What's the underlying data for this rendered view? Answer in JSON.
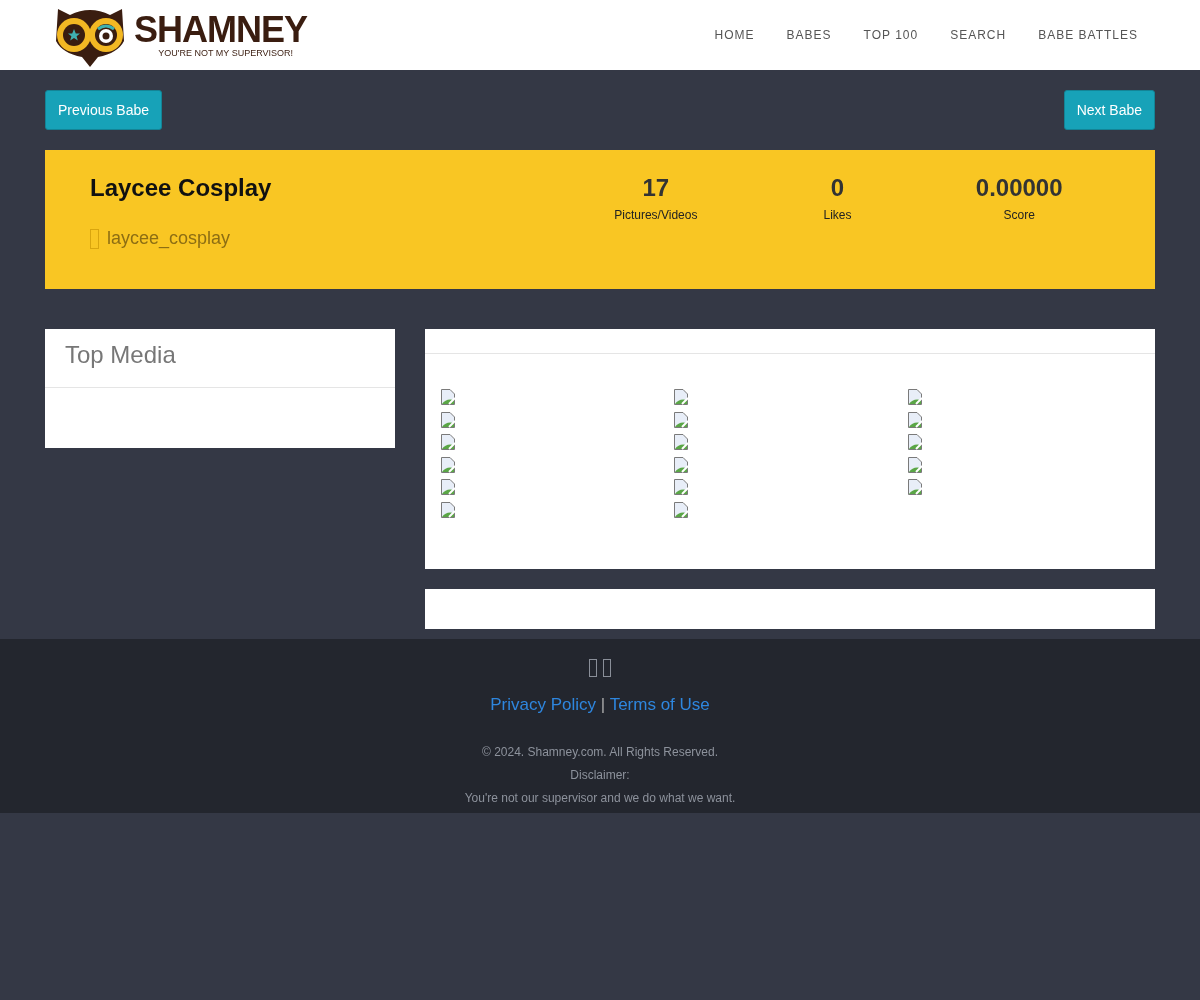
{
  "brand": {
    "name": "SHAMNEY",
    "tagline": "YOU'RE NOT MY SUPERVISOR!"
  },
  "nav": [
    {
      "label": "HOME"
    },
    {
      "label": "BABES"
    },
    {
      "label": "TOP 100"
    },
    {
      "label": "SEARCH"
    },
    {
      "label": "BABE BATTLES"
    }
  ],
  "pager": {
    "previous": "Previous Babe",
    "next": "Next Babe"
  },
  "profile": {
    "name": "Laycee Cosplay",
    "handle": "laycee_cosplay",
    "stats": [
      {
        "value": "17",
        "label": "Pictures/Videos"
      },
      {
        "value": "0",
        "label": "Likes"
      },
      {
        "value": "0.00000",
        "label": "Score"
      }
    ]
  },
  "sidebar": {
    "title": "Top Media"
  },
  "media": [
    {
      "kind": "broken-image"
    },
    {
      "kind": "broken-image"
    },
    {
      "kind": "broken-image"
    },
    {
      "kind": "broken-image"
    },
    {
      "kind": "broken-image"
    },
    {
      "kind": "broken-image"
    },
    {
      "kind": "broken-image"
    },
    {
      "kind": "broken-image"
    },
    {
      "kind": "broken-image"
    },
    {
      "kind": "broken-image"
    },
    {
      "kind": "broken-image"
    },
    {
      "kind": "broken-image"
    },
    {
      "kind": "broken-image"
    },
    {
      "kind": "broken-image"
    },
    {
      "kind": "broken-image"
    },
    {
      "kind": "broken-image"
    },
    {
      "kind": "broken-image"
    }
  ],
  "footer": {
    "links": [
      {
        "label": "Privacy Policy"
      },
      {
        "label": "Terms of Use"
      }
    ],
    "separator": "|",
    "copyright": "© 2024. Shamney.com. All Rights Reserved.",
    "disclaimer_title": "Disclaimer:",
    "disclaimer": "You're not our supervisor and we do what we want."
  }
}
